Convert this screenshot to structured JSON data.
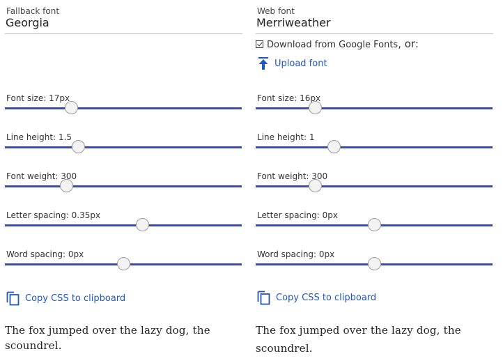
{
  "fallback": {
    "label": "Fallback font",
    "font": "Georgia",
    "sliders": [
      {
        "label": "Font size: 17px",
        "fraction": 0.28
      },
      {
        "label": "Line height: 1.5",
        "fraction": 0.31
      },
      {
        "label": "Font weight: 300",
        "fraction": 0.26
      },
      {
        "label": "Letter spacing: 0.35px",
        "fraction": 0.58
      },
      {
        "label": "Word spacing: 0px",
        "fraction": 0.5
      }
    ],
    "copy_label": "Copy CSS to clipboard",
    "sample_text": "The fox jumped over the lazy dog, the scoundrel."
  },
  "web": {
    "label": "Web font",
    "font": "Merriweather",
    "download_label": "Download from Google Fonts",
    "download_suffix": ", or:",
    "download_checked": true,
    "upload_label": "Upload font",
    "sliders": [
      {
        "label": "Font size: 16px",
        "fraction": 0.25
      },
      {
        "label": "Line height: 1",
        "fraction": 0.33
      },
      {
        "label": "Font weight: 300",
        "fraction": 0.25
      },
      {
        "label": "Letter spacing: 0px",
        "fraction": 0.5
      },
      {
        "label": "Word spacing: 0px",
        "fraction": 0.5
      }
    ],
    "copy_label": "Copy CSS to clipboard",
    "sample_text": "The fox jumped over the lazy dog, the scoundrel."
  },
  "colors": {
    "accent": "#1f56c2",
    "track": "#3e4ea3"
  },
  "icons": {
    "upload": "upload-arrow-icon",
    "copy": "copy-icon",
    "check": "checkbox-check-icon"
  }
}
